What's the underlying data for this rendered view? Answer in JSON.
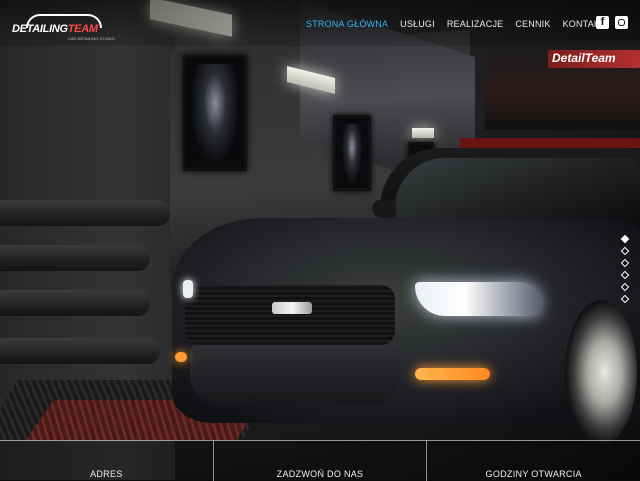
{
  "brand": {
    "name_part1": "DETAILING",
    "name_part2": "TEAM",
    "tagline": "CAR DETAILING STUDIO"
  },
  "nav": {
    "items": [
      {
        "label": "STRONA GŁÓWNA",
        "active": true
      },
      {
        "label": "USŁUGI",
        "active": false
      },
      {
        "label": "REALIZACJE",
        "active": false
      },
      {
        "label": "CENNIK",
        "active": false
      },
      {
        "label": "KONTAKT",
        "active": false
      }
    ],
    "accent": "#39b4ea"
  },
  "social": {
    "facebook": "f",
    "instagram_icon": "instagram-icon"
  },
  "background_sign": "DetailTeam",
  "slider": {
    "slide_count": 6,
    "active_index": 0
  },
  "footer": {
    "col1": "ADRES",
    "col2": "ZADZWOŃ DO NAS",
    "col3": "GODZINY OTWARCIA"
  }
}
